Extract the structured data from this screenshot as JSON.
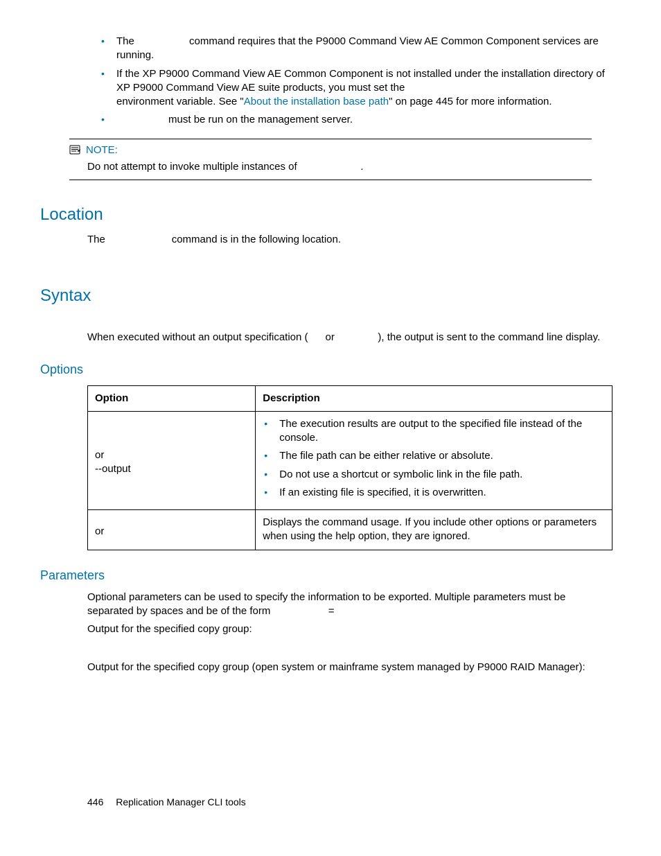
{
  "intro": {
    "bullets": [
      {
        "pre": "The ",
        "post": " command requires that the P9000 Command View AE Common Component services are running."
      },
      {
        "line1": "If the XP P9000 Command View AE Common Component is not installed under the installation directory of XP P9000 Command View AE suite products, you must set the ",
        "line2_pre": "environment variable. See \"",
        "link": "About the installation base path",
        "line2_post": "\" on page 445 for more information."
      },
      {
        "post": " must be run on the management server."
      }
    ]
  },
  "note": {
    "title": "NOTE:",
    "body_pre": "Do not attempt to invoke multiple instances of ",
    "body_post": "."
  },
  "location": {
    "heading": "Location",
    "text_pre": "The ",
    "text_post": " command is in the following location."
  },
  "syntax": {
    "heading": "Syntax",
    "text_pre": "When executed without an output specification (",
    "or": " or ",
    "text_post": "), the output is sent to the command line display."
  },
  "options": {
    "heading": "Options",
    "th_option": "Option",
    "th_desc": "Description",
    "rows": [
      {
        "opt_line1": "",
        "conj": "or",
        "opt_line2": "--output",
        "desc_bullets": [
          "The execution results are output to the specified file instead of the console.",
          "The file path can be either relative or absolute.",
          "Do not use a shortcut or symbolic link in the file path.",
          "If an existing file is specified, it is overwritten."
        ]
      },
      {
        "opt_line1": "",
        "conj": "or",
        "opt_line2": "",
        "desc_text": "Displays the command usage. If you include other options or parameters when using the help option, they are ignored."
      }
    ]
  },
  "parameters": {
    "heading": "Parameters",
    "p1_pre": "Optional parameters can be used to specify the information to be exported. Multiple parameters must be separated by spaces and be of the form ",
    "eq": "=",
    "p2": "Output for the specified copy group:",
    "p3": "Output for the specified copy group (open system or mainframe system managed by P9000 RAID Manager):"
  },
  "footer": {
    "page": "446",
    "title": "Replication Manager CLI tools"
  }
}
